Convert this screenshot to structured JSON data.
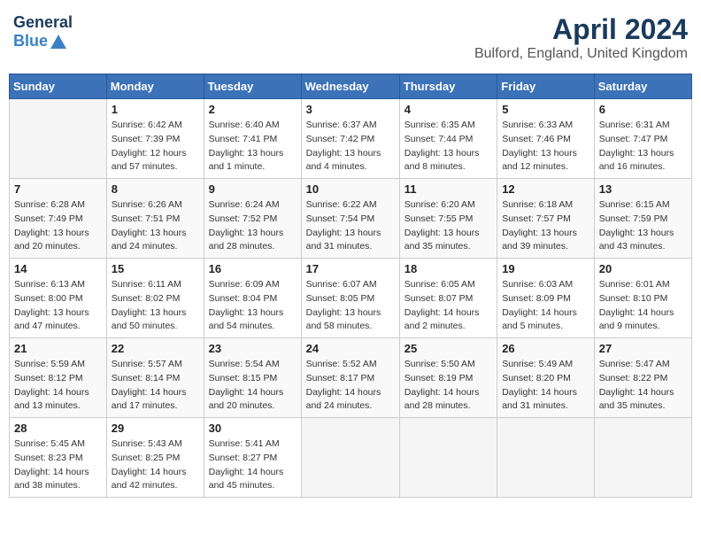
{
  "header": {
    "logo_general": "General",
    "logo_blue": "Blue",
    "title": "April 2024",
    "location": "Bulford, England, United Kingdom"
  },
  "days_of_week": [
    "Sunday",
    "Monday",
    "Tuesday",
    "Wednesday",
    "Thursday",
    "Friday",
    "Saturday"
  ],
  "weeks": [
    [
      {
        "day": "",
        "sunrise": "",
        "sunset": "",
        "daylight": ""
      },
      {
        "day": "1",
        "sunrise": "Sunrise: 6:42 AM",
        "sunset": "Sunset: 7:39 PM",
        "daylight": "Daylight: 12 hours and 57 minutes."
      },
      {
        "day": "2",
        "sunrise": "Sunrise: 6:40 AM",
        "sunset": "Sunset: 7:41 PM",
        "daylight": "Daylight: 13 hours and 1 minute."
      },
      {
        "day": "3",
        "sunrise": "Sunrise: 6:37 AM",
        "sunset": "Sunset: 7:42 PM",
        "daylight": "Daylight: 13 hours and 4 minutes."
      },
      {
        "day": "4",
        "sunrise": "Sunrise: 6:35 AM",
        "sunset": "Sunset: 7:44 PM",
        "daylight": "Daylight: 13 hours and 8 minutes."
      },
      {
        "day": "5",
        "sunrise": "Sunrise: 6:33 AM",
        "sunset": "Sunset: 7:46 PM",
        "daylight": "Daylight: 13 hours and 12 minutes."
      },
      {
        "day": "6",
        "sunrise": "Sunrise: 6:31 AM",
        "sunset": "Sunset: 7:47 PM",
        "daylight": "Daylight: 13 hours and 16 minutes."
      }
    ],
    [
      {
        "day": "7",
        "sunrise": "Sunrise: 6:28 AM",
        "sunset": "Sunset: 7:49 PM",
        "daylight": "Daylight: 13 hours and 20 minutes."
      },
      {
        "day": "8",
        "sunrise": "Sunrise: 6:26 AM",
        "sunset": "Sunset: 7:51 PM",
        "daylight": "Daylight: 13 hours and 24 minutes."
      },
      {
        "day": "9",
        "sunrise": "Sunrise: 6:24 AM",
        "sunset": "Sunset: 7:52 PM",
        "daylight": "Daylight: 13 hours and 28 minutes."
      },
      {
        "day": "10",
        "sunrise": "Sunrise: 6:22 AM",
        "sunset": "Sunset: 7:54 PM",
        "daylight": "Daylight: 13 hours and 31 minutes."
      },
      {
        "day": "11",
        "sunrise": "Sunrise: 6:20 AM",
        "sunset": "Sunset: 7:55 PM",
        "daylight": "Daylight: 13 hours and 35 minutes."
      },
      {
        "day": "12",
        "sunrise": "Sunrise: 6:18 AM",
        "sunset": "Sunset: 7:57 PM",
        "daylight": "Daylight: 13 hours and 39 minutes."
      },
      {
        "day": "13",
        "sunrise": "Sunrise: 6:15 AM",
        "sunset": "Sunset: 7:59 PM",
        "daylight": "Daylight: 13 hours and 43 minutes."
      }
    ],
    [
      {
        "day": "14",
        "sunrise": "Sunrise: 6:13 AM",
        "sunset": "Sunset: 8:00 PM",
        "daylight": "Daylight: 13 hours and 47 minutes."
      },
      {
        "day": "15",
        "sunrise": "Sunrise: 6:11 AM",
        "sunset": "Sunset: 8:02 PM",
        "daylight": "Daylight: 13 hours and 50 minutes."
      },
      {
        "day": "16",
        "sunrise": "Sunrise: 6:09 AM",
        "sunset": "Sunset: 8:04 PM",
        "daylight": "Daylight: 13 hours and 54 minutes."
      },
      {
        "day": "17",
        "sunrise": "Sunrise: 6:07 AM",
        "sunset": "Sunset: 8:05 PM",
        "daylight": "Daylight: 13 hours and 58 minutes."
      },
      {
        "day": "18",
        "sunrise": "Sunrise: 6:05 AM",
        "sunset": "Sunset: 8:07 PM",
        "daylight": "Daylight: 14 hours and 2 minutes."
      },
      {
        "day": "19",
        "sunrise": "Sunrise: 6:03 AM",
        "sunset": "Sunset: 8:09 PM",
        "daylight": "Daylight: 14 hours and 5 minutes."
      },
      {
        "day": "20",
        "sunrise": "Sunrise: 6:01 AM",
        "sunset": "Sunset: 8:10 PM",
        "daylight": "Daylight: 14 hours and 9 minutes."
      }
    ],
    [
      {
        "day": "21",
        "sunrise": "Sunrise: 5:59 AM",
        "sunset": "Sunset: 8:12 PM",
        "daylight": "Daylight: 14 hours and 13 minutes."
      },
      {
        "day": "22",
        "sunrise": "Sunrise: 5:57 AM",
        "sunset": "Sunset: 8:14 PM",
        "daylight": "Daylight: 14 hours and 17 minutes."
      },
      {
        "day": "23",
        "sunrise": "Sunrise: 5:54 AM",
        "sunset": "Sunset: 8:15 PM",
        "daylight": "Daylight: 14 hours and 20 minutes."
      },
      {
        "day": "24",
        "sunrise": "Sunrise: 5:52 AM",
        "sunset": "Sunset: 8:17 PM",
        "daylight": "Daylight: 14 hours and 24 minutes."
      },
      {
        "day": "25",
        "sunrise": "Sunrise: 5:50 AM",
        "sunset": "Sunset: 8:19 PM",
        "daylight": "Daylight: 14 hours and 28 minutes."
      },
      {
        "day": "26",
        "sunrise": "Sunrise: 5:49 AM",
        "sunset": "Sunset: 8:20 PM",
        "daylight": "Daylight: 14 hours and 31 minutes."
      },
      {
        "day": "27",
        "sunrise": "Sunrise: 5:47 AM",
        "sunset": "Sunset: 8:22 PM",
        "daylight": "Daylight: 14 hours and 35 minutes."
      }
    ],
    [
      {
        "day": "28",
        "sunrise": "Sunrise: 5:45 AM",
        "sunset": "Sunset: 8:23 PM",
        "daylight": "Daylight: 14 hours and 38 minutes."
      },
      {
        "day": "29",
        "sunrise": "Sunrise: 5:43 AM",
        "sunset": "Sunset: 8:25 PM",
        "daylight": "Daylight: 14 hours and 42 minutes."
      },
      {
        "day": "30",
        "sunrise": "Sunrise: 5:41 AM",
        "sunset": "Sunset: 8:27 PM",
        "daylight": "Daylight: 14 hours and 45 minutes."
      },
      {
        "day": "",
        "sunrise": "",
        "sunset": "",
        "daylight": ""
      },
      {
        "day": "",
        "sunrise": "",
        "sunset": "",
        "daylight": ""
      },
      {
        "day": "",
        "sunrise": "",
        "sunset": "",
        "daylight": ""
      },
      {
        "day": "",
        "sunrise": "",
        "sunset": "",
        "daylight": ""
      }
    ]
  ]
}
